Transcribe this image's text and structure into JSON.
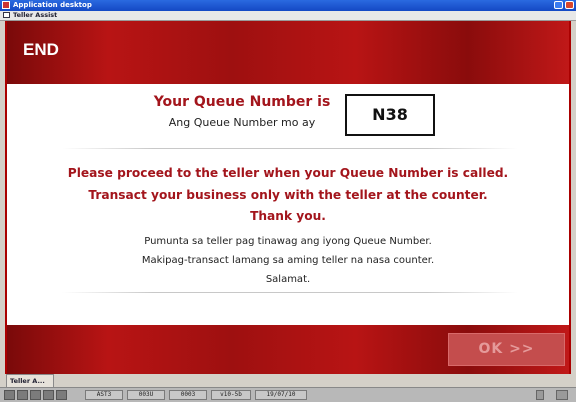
{
  "window": {
    "title": "Application desktop"
  },
  "inner_window": {
    "title": "Teller Assist"
  },
  "header": {
    "label": "END"
  },
  "queue": {
    "heading": "Your Queue Number is",
    "subheading": "Ang Queue Number mo ay",
    "number": "N38"
  },
  "message_en": {
    "line1": "Please proceed to the teller when your Queue Number is called.",
    "line2": "Transact your business only with the teller at the counter.",
    "line3": "Thank you."
  },
  "message_fil": {
    "line1": "Pumunta sa teller pag tinawag ang iyong Queue Number.",
    "line2": "Makipag-transact lamang sa aming teller na nasa counter.",
    "line3": "Salamat."
  },
  "footer": {
    "ok_label": "OK >>"
  },
  "taskbar": {
    "tab_label": "Teller A..."
  },
  "statusbar": {
    "fields": [
      "AST3",
      "003U",
      "0003",
      "v10-5b",
      "19/07/10"
    ]
  },
  "colors": {
    "brand_red": "#b81414",
    "text_red": "#a3151c"
  }
}
